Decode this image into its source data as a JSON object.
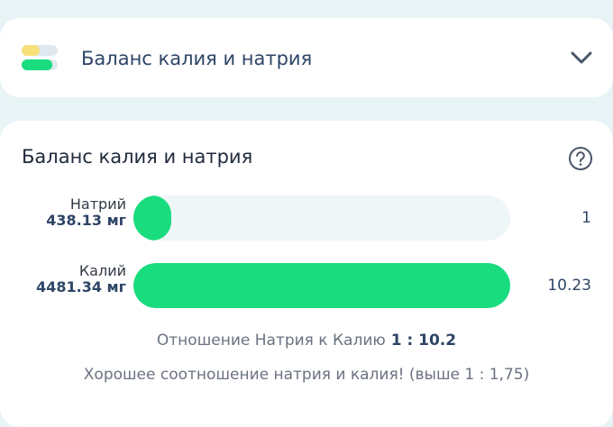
{
  "header": {
    "title": "Баланс калия и натрия"
  },
  "section": {
    "title": "Баланс калия и натрия"
  },
  "rows": [
    {
      "name": "Натрий",
      "amount": "438.13 мг",
      "ratio": "1",
      "fill_fraction": 0.098
    },
    {
      "name": "Калий",
      "amount": "4481.34 мг",
      "ratio": "10.23",
      "fill_fraction": 1.0
    }
  ],
  "summary": {
    "ratio_label": "Отношение Натрия к Калию",
    "ratio_value": "1 : 10.2",
    "note": "Хорошее соотношение натрия и калия! (выше 1 : 1,75)"
  },
  "colors": {
    "accent_green": "#19dc7e",
    "accent_yellow": "#f7e07a",
    "track": "#eef6f7",
    "title": "#2e4566"
  },
  "icons": {
    "header": "balance-bars-icon",
    "toggle": "chevron-down-icon",
    "help": "question-circle-icon"
  }
}
